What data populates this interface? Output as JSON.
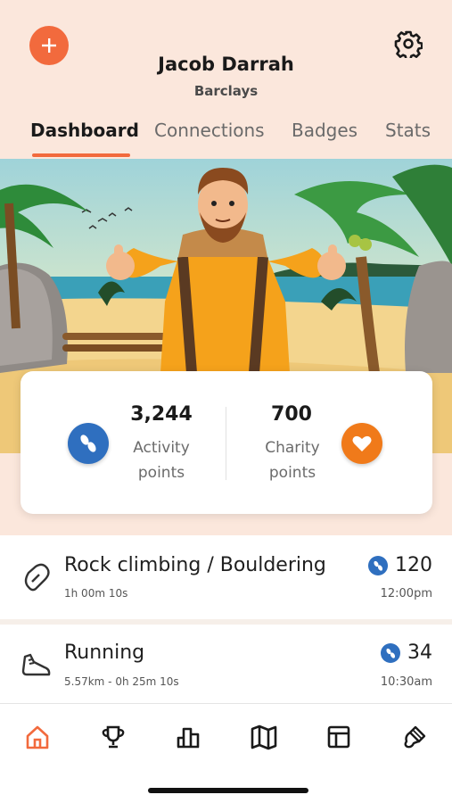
{
  "profile": {
    "name": "Jacob Darrah",
    "company": "Barclays"
  },
  "tabs": [
    {
      "label": "Dashboard",
      "active": true
    },
    {
      "label": "Connections",
      "active": false
    },
    {
      "label": "Badges",
      "active": false
    },
    {
      "label": "Stats",
      "active": false
    }
  ],
  "summary": {
    "activity_points": "3,244",
    "activity_label_line1": "Activity",
    "activity_label_line2": "points",
    "charity_points": "700",
    "charity_label_line1": "Charity",
    "charity_label_line2": "points"
  },
  "activities": [
    {
      "title": "Rock climbing / Bouldering",
      "details": "1h 00m 10s",
      "points": "120",
      "time": "12:00pm",
      "icon": "carabiner-icon"
    },
    {
      "title": "Running",
      "details": "5.57km - 0h 25m 10s",
      "points": "34",
      "time": "10:30am",
      "icon": "running-shoe-icon"
    }
  ],
  "nav": [
    {
      "name": "home-icon",
      "active": true
    },
    {
      "name": "trophy-icon",
      "active": false
    },
    {
      "name": "bar-chart-icon",
      "active": false
    },
    {
      "name": "map-icon",
      "active": false
    },
    {
      "name": "layout-icon",
      "active": false
    },
    {
      "name": "paint-brush-icon",
      "active": false
    }
  ],
  "colors": {
    "accent": "#f26a3d",
    "header_bg": "#fbe7dc",
    "activity_blue": "#2f6fbf",
    "charity_orange": "#f07a1a"
  }
}
